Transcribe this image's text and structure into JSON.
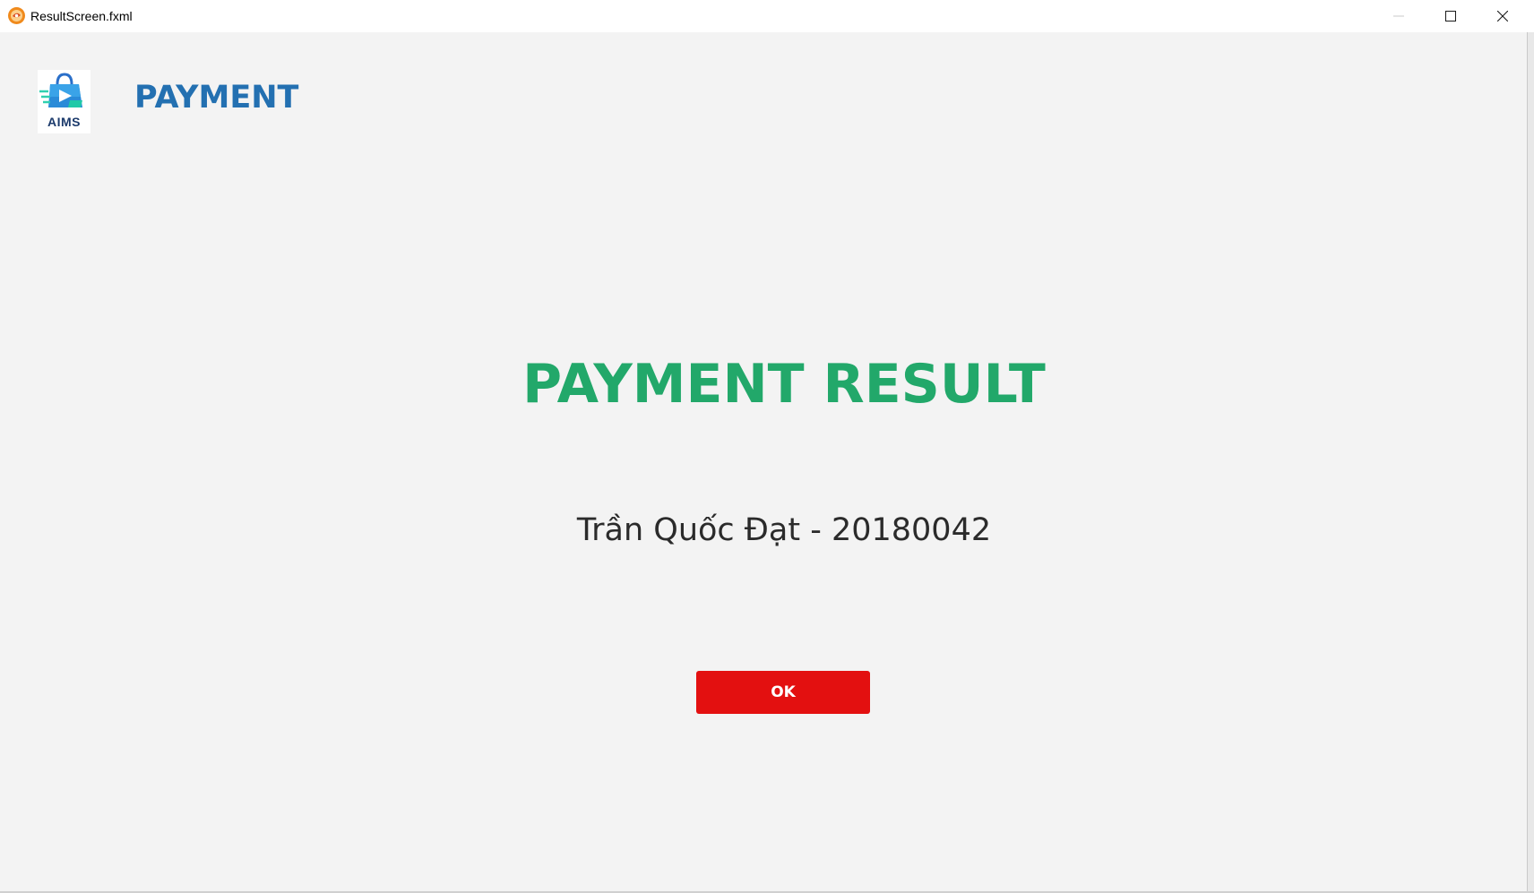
{
  "window": {
    "title": "ResultScreen.fxml",
    "app_icon": "javafx-app-icon",
    "controls": {
      "minimize_icon": "minimize-icon",
      "maximize_icon": "maximize-icon",
      "close_icon": "close-icon"
    }
  },
  "header": {
    "logo_text": "AIMS",
    "title": "PAYMENT"
  },
  "result": {
    "title": "PAYMENT RESULT",
    "message": "Trần Quốc Đạt - 20180042"
  },
  "actions": {
    "ok_label": "OK"
  },
  "colors": {
    "header_title": "#2370b1",
    "result_title": "#22a86a",
    "ok_button": "#e31010",
    "background": "#f3f3f3"
  }
}
